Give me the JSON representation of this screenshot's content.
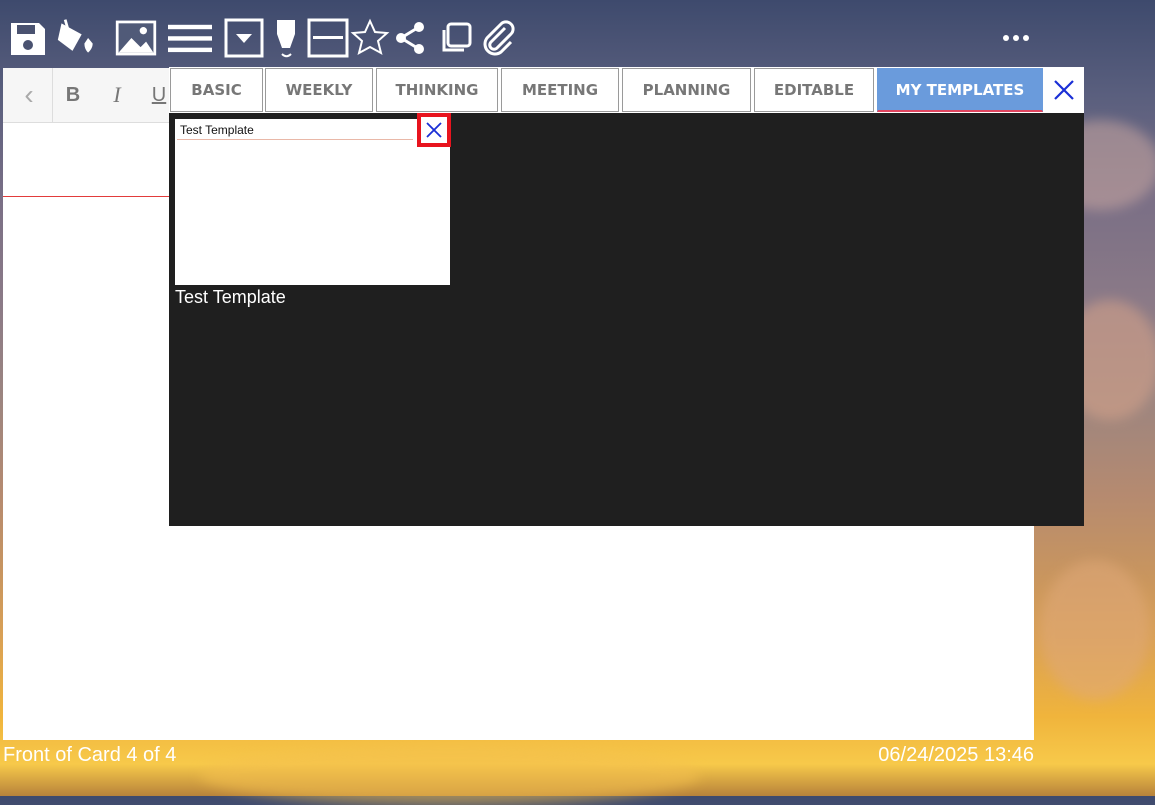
{
  "toolbar": {
    "icons": [
      "save-icon",
      "paint-bucket-icon",
      "image-icon",
      "lines-icon",
      "dropdown-icon",
      "highlighter-icon",
      "horizontal-rule-icon",
      "star-icon",
      "share-icon",
      "copy-icon",
      "paperclip-icon",
      "more-icon"
    ]
  },
  "format_bar": {
    "back_glyph": "‹",
    "bold": "B",
    "italic": "I",
    "underline": "U"
  },
  "templates_panel": {
    "tabs": [
      "BASIC",
      "WEEKLY",
      "THINKING",
      "MEETING",
      "PLANNING",
      "EDITABLE",
      "MY TEMPLATES"
    ],
    "active_tab": "MY TEMPLATES",
    "templates": [
      {
        "title": "Test Template",
        "caption": "Test Template"
      }
    ]
  },
  "footer": {
    "card_position": "Front of Card 4 of 4",
    "timestamp": "06/24/2025 13:46"
  },
  "colors": {
    "active_tab_bg": "#6a9bdc",
    "close_icon": "#1a2fd6",
    "highlight_box": "#e8141e",
    "panel_bg": "#1f1f1f"
  }
}
